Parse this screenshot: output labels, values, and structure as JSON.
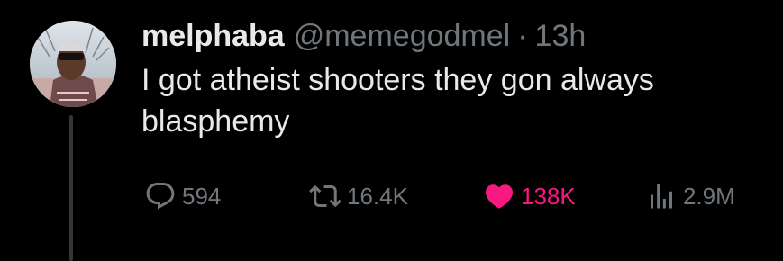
{
  "tweet": {
    "display_name": "melphaba",
    "handle": "@memegodmel",
    "separator": "·",
    "time": "13h",
    "text": "I got atheist shooters they gon always blasphemy"
  },
  "actions": {
    "replies": "594",
    "retweets": "16.4K",
    "likes": "138K",
    "views": "2.9M"
  },
  "icons": {
    "reply": "reply-bubble-icon",
    "retweet": "retweet-arrows-icon",
    "like": "heart-filled-icon",
    "views": "bar-chart-icon"
  },
  "colors": {
    "background": "#000000",
    "text_primary": "#e7e9ea",
    "text_secondary": "#71767b",
    "like_active": "#f91880",
    "thread_line": "#333639"
  }
}
